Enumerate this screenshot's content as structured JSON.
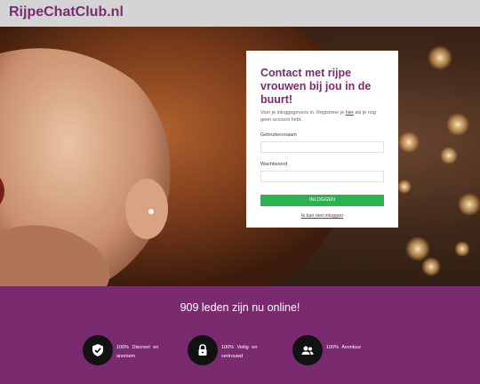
{
  "header": {
    "logo": "RijpeChatClub.nl"
  },
  "login": {
    "title": "Contact met rijpe vrouwen bij jou in de buurt!",
    "subtitle_before": "Voer je inloggegevens in. Registreer je",
    "subtitle_link": "hier",
    "subtitle_after": "als je nog geen account hebt.",
    "username_label": "Gebruikersnaam",
    "username_value": "",
    "password_label": "Wachtwoord",
    "password_value": "",
    "login_button": "INLOGGEN",
    "forgot_link": "Ik kan niet inloggen"
  },
  "stats": {
    "online_text": "909 leden zijn nu online!"
  },
  "features": [
    {
      "icon": "shield-check-icon",
      "text": "100% Discreet en anoniem"
    },
    {
      "icon": "lock-icon",
      "text": "100% Veilig en vertrouwd"
    },
    {
      "icon": "users-icon",
      "text": "100% Avontuur"
    }
  ],
  "colors": {
    "brand": "#7c2a71",
    "button": "#2bb34f",
    "band": "#7a2a6e",
    "topbar": "#d4d4d4"
  }
}
